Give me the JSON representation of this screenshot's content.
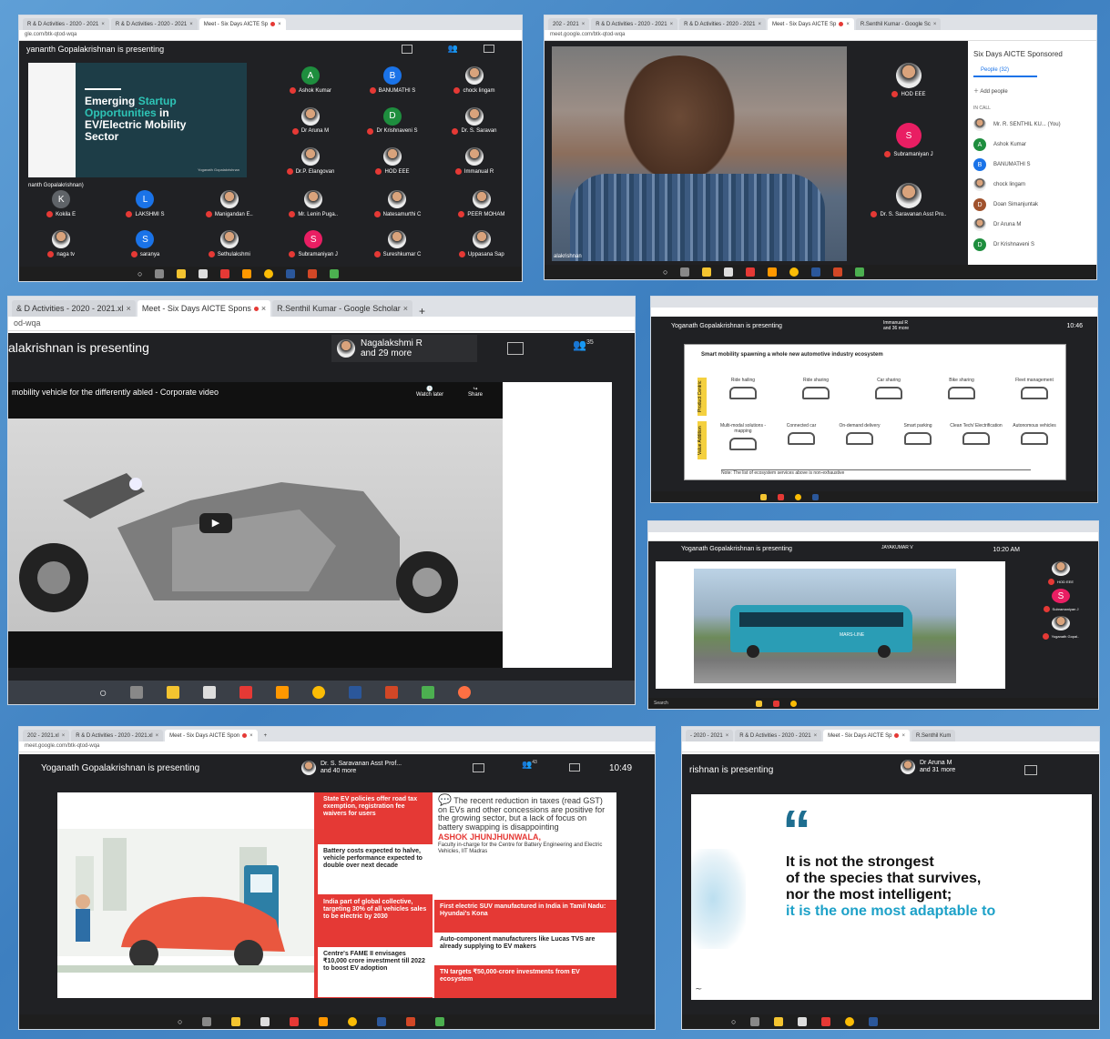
{
  "p1": {
    "tabs": [
      "R & D Activities - 2020 - 2021",
      "R & D Activities - 2020 - 2021",
      "Meet - Six Days AICTE Sp"
    ],
    "url": "gle.com/btk-qtod-wqa",
    "presenting": "yananth Gopalakrishnan is presenting",
    "slide": {
      "line1": "Emerging",
      "line1b": "Startup",
      "line2": "Opportunities",
      "line2b": "in",
      "line3": "EV/Electric Mobility",
      "line4": "Sector",
      "author": "Yoganath Gopalakrishnan",
      "footer": "nanth Gopalakrishnan)"
    },
    "participants": [
      {
        "name": "Ashok Kumar",
        "letter": "A",
        "color": "#1e8e3e"
      },
      {
        "name": "BANUMATHI S",
        "letter": "B",
        "color": "#1a73e8"
      },
      {
        "name": "chock lingam",
        "letter": "",
        "color": ""
      },
      {
        "name": "Dr Aruna M",
        "letter": "",
        "color": ""
      },
      {
        "name": "Dr Krishnaveni S",
        "letter": "D",
        "color": "#1e8e3e"
      },
      {
        "name": "Dr. S. Saravan",
        "letter": "",
        "color": ""
      },
      {
        "name": "Dr.P. Elangovan",
        "letter": "",
        "color": ""
      },
      {
        "name": "HOD EEE",
        "letter": "",
        "color": ""
      },
      {
        "name": "Immanual R",
        "letter": "",
        "color": ""
      }
    ],
    "row2": [
      {
        "name": "Kokila E",
        "letter": "K",
        "color": "#5f6368"
      },
      {
        "name": "LAKSHMI S",
        "letter": "L",
        "color": "#1a73e8"
      },
      {
        "name": "Manigandan E..",
        "letter": "",
        "color": ""
      },
      {
        "name": "Mr. Lenin Puga..",
        "letter": "",
        "color": ""
      },
      {
        "name": "Natesamurthi C",
        "letter": "",
        "color": ""
      },
      {
        "name": "PEER MOHAM",
        "letter": "",
        "color": ""
      }
    ],
    "row3": [
      {
        "name": "naga tv",
        "letter": "",
        "color": ""
      },
      {
        "name": "saranya",
        "letter": "S",
        "color": "#1a73e8"
      },
      {
        "name": "Sethulakshmi",
        "letter": "",
        "color": ""
      },
      {
        "name": "Subramaniyan J",
        "letter": "S",
        "color": "#e91e63"
      },
      {
        "name": "Sureshkumar C",
        "letter": "",
        "color": ""
      },
      {
        "name": "Uppasana Sap",
        "letter": "",
        "color": ""
      }
    ]
  },
  "p2": {
    "tabs": [
      "202 - 2021",
      "R & D Activities - 2020 - 2021",
      "R & D Activities - 2020 - 2021",
      "Meet - Six Days AICTE Sp",
      "R.Senthil Kumar - Google Sc"
    ],
    "url": "meet.google.com/btk-qtod-wqa",
    "title": "Six Days AICTE Sponsored",
    "people_tab": "People (32)",
    "add": "Add people",
    "in_call": "IN CALL",
    "people": [
      {
        "name": "Mr. R. SENTHIL KU... (You)",
        "letter": "",
        "color": ""
      },
      {
        "name": "Ashok Kumar",
        "letter": "A",
        "color": "#1e8e3e"
      },
      {
        "name": "BANUMATHI S",
        "letter": "B",
        "color": "#1a73e8"
      },
      {
        "name": "chock lingam",
        "letter": "",
        "color": ""
      },
      {
        "name": "Doan Simanjuntak",
        "letter": "D",
        "color": "#a0522d"
      },
      {
        "name": "Dr Aruna M",
        "letter": "",
        "color": ""
      },
      {
        "name": "Dr Krishnaveni S",
        "letter": "D",
        "color": "#1e8e3e"
      }
    ],
    "side": [
      {
        "name": "HOD EEE"
      },
      {
        "name": "Subramaniyan J",
        "letter": "S",
        "color": "#e91e63"
      },
      {
        "name": "Dr. S. Saravanan Asst Pro.."
      }
    ],
    "video_label": "alakrishnan"
  },
  "p3": {
    "tabs": [
      "& D Activities - 2020 - 2021.xl",
      "Meet - Six Days AICTE Spons",
      "R.Senthil Kumar - Google Scholar"
    ],
    "url": "od-wqa",
    "presenting": "alakrishnan is presenting",
    "user": "Nagalakshmi R",
    "more": "and 29 more",
    "count": "35",
    "video_title": "mobility vehicle for the differently abled - Corporate video",
    "watch_later": "Watch later",
    "share": "Share"
  },
  "p4": {
    "presenting": "Yoganath Gopalakrishnan is presenting",
    "user": "Immanual R",
    "more": "and 36 more",
    "time": "10:46",
    "heading": "Smart mobility spawning a whole new automotive industry ecosystem",
    "row1_label": "Product Centric",
    "row2_label": "Value Addition",
    "row1": [
      "Ride hailing",
      "Ride sharing",
      "Car sharing",
      "Bike sharing",
      "Fleet management"
    ],
    "row2": [
      "Multi-modal solutions - mapping",
      "Connected car",
      "On-demand delivery",
      "Smart parking",
      "Clean Tech/ Electrification",
      "Autonomous vehicles"
    ],
    "note": "Note: The list of ecosystem services above is non-exhaustive"
  },
  "p5": {
    "presenting": "Yoganath Gopalakrishnan is presenting",
    "user": "JAYAKUMAR V",
    "time": "10:20 AM",
    "bus_text": "MARS-LINE",
    "side": [
      "HOD EEE",
      "Subramaniyan J",
      "Yoganath Gopal.."
    ],
    "search": "Search"
  },
  "p6": {
    "tabs": [
      "202 - 2021.xl",
      "R & D Activities - 2020 - 2021.xl",
      "Meet - Six Days AICTE Spon"
    ],
    "url": "meet.google.com/btk-qtod-wqa",
    "presenting": "Yoganath Gopalakrishnan is presenting",
    "user": "Dr. S. Saravanan Asst Prof...",
    "more": "and 40 more",
    "count": "43",
    "time": "10:49",
    "left": [
      "State EV policies offer road tax exemption, registration fee waivers for users",
      "Battery costs expected to halve, vehicle performance expected to double over next decade",
      "India part of global collective, targeting 30% of all vehicles sales to be electric by 2030",
      "Centre's FAME II envisages ₹10,000 crore investment till 2022 to boost EV adoption"
    ],
    "quote": "The recent reduction in taxes (read GST) on EVs and other concessions are positive for the growing sector, but a lack of focus on battery swapping is disappointing",
    "quote_name": "ASHOK JHUNJHUNWALA,",
    "quote_role": "Faculty in-charge for the Centre for Battery Engineering and Electric Vehicles, IIT Madras",
    "right": [
      "First electric SUV manufactured in India in Tamil Nadu: Hyundai's Kona",
      "Auto-component manufacturers like Lucas TVS are already supplying to EV makers",
      "TN targets ₹50,000-crore investments from EV ecosystem"
    ]
  },
  "p7": {
    "tabs": [
      "- 2020 - 2021",
      "R & D Activities - 2020 - 2021",
      "Meet - Six Days AICTE Sp",
      "R.Senthil Kum"
    ],
    "presenting": "rishnan is presenting",
    "user": "Dr Aruna M",
    "more": "and 31 more",
    "quote1": "It is not the strongest",
    "quote2": "of the species that survives,",
    "quote3": "nor the most intelligent;",
    "quote4": "it is the one most adaptable to"
  }
}
